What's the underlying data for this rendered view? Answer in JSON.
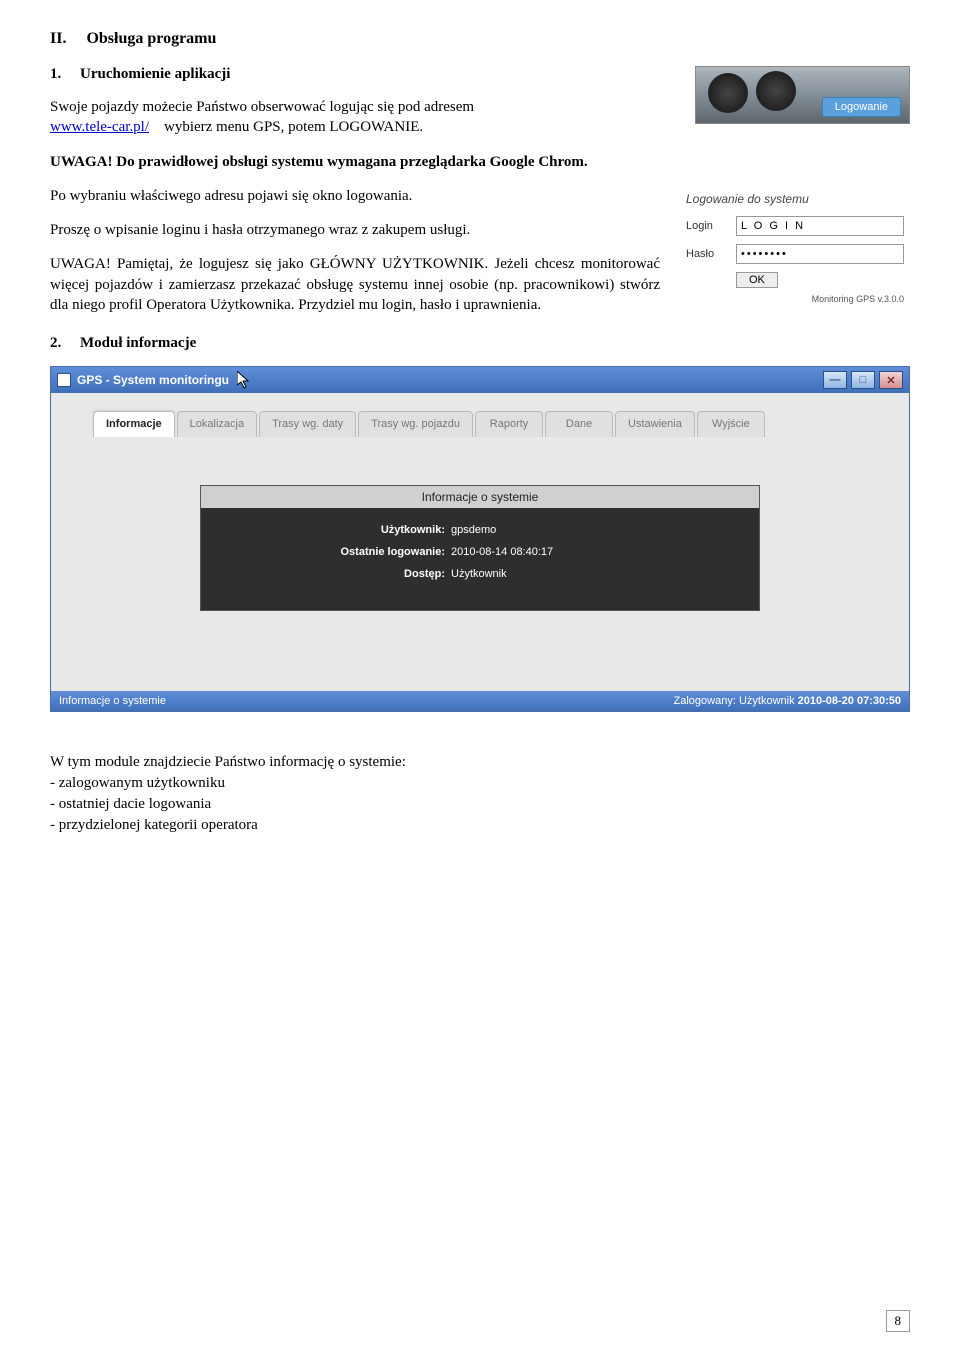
{
  "section": {
    "number": "II.",
    "title": "Obsługa programu"
  },
  "sub1": {
    "number": "1.",
    "title": "Uruchomienie aplikacji"
  },
  "p1a": "Swoje pojazdy możecie Państwo obserwować logując się pod adresem",
  "link": "www.tele-car.pl/",
  "p1b": "wybierz menu GPS, potem LOGOWANIE.",
  "p2": "UWAGA! Do prawidłowej obsługi systemu wymagana przeglądarka Google Chrom.",
  "p3": "Po wybraniu właściwego adresu pojawi się okno logowania.",
  "p4": "Proszę o wpisanie loginu i hasła otrzymanego wraz z zakupem usługi.",
  "p5": "UWAGA! Pamiętaj, że logujesz się jako GŁÓWNY UŻYTKOWNIK. Jeżeli chcesz monitorować więcej pojazdów i zamierzasz przekazać obsługę systemu innej osobie (np. pracownikowi) stwórz dla niego profil Operatora Użytkownika. Przydziel mu login, hasło i uprawnienia.",
  "sub2": {
    "number": "2.",
    "title": "Moduł informacje"
  },
  "banner_button": "Logowanie",
  "login": {
    "title": "Logowanie do systemu",
    "login_label": "Login",
    "login_value": "L O G I N",
    "password_label": "Hasło",
    "password_value": "••••••••",
    "ok": "OK",
    "version": "Monitoring GPS v.3.0.0"
  },
  "app": {
    "title": "GPS - System monitoringu",
    "tabs": [
      "Informacje",
      "Lokalizacja",
      "Trasy wg. daty",
      "Trasy wg. pojazdu",
      "Raporty",
      "Dane",
      "Ustawienia",
      "Wyjście"
    ],
    "panel_title": "Informacje o systemie",
    "rows": [
      {
        "label": "Użytkownik:",
        "value": "gpsdemo"
      },
      {
        "label": "Ostatnie logowanie:",
        "value": "2010-08-14 08:40:17"
      },
      {
        "label": "Dostęp:",
        "value": "Użytkownik"
      }
    ],
    "status_left": "Informacje o systemie",
    "status_right_label": "Zalogowany:",
    "status_right_role": "Użytkownik",
    "status_right_time": "2010-08-20 07:30:50"
  },
  "footer": {
    "intro": "W tym module znajdziecie Państwo informację o systemie:",
    "items": [
      "- zalogowanym użytkowniku",
      "- ostatniej dacie logowania",
      "- przydzielonej kategorii operatora"
    ]
  },
  "page_number": "8"
}
